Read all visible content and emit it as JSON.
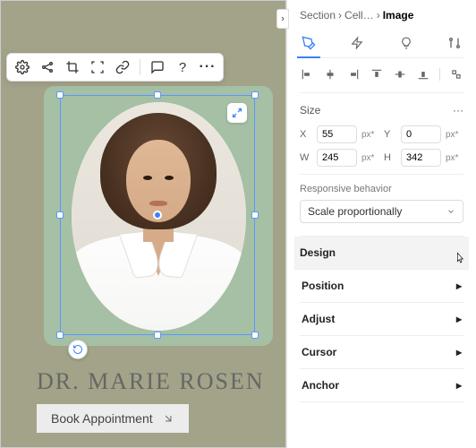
{
  "breadcrumb": {
    "section": "Section",
    "cell": "Cell…",
    "image": "Image"
  },
  "toolbar": {
    "icons": [
      "gear",
      "connect",
      "crop",
      "focus",
      "link",
      "comment",
      "help",
      "more"
    ]
  },
  "size_section": {
    "label": "Size",
    "x_label": "X",
    "x_value": "55",
    "x_unit": "px*",
    "y_label": "Y",
    "y_value": "0",
    "y_unit": "px*",
    "w_label": "W",
    "w_value": "245",
    "w_unit": "px*",
    "h_label": "H",
    "h_value": "342",
    "h_unit": "px*"
  },
  "responsive": {
    "label": "Responsive behavior",
    "value": "Scale proportionally"
  },
  "accordion": {
    "design": "Design",
    "position": "Position",
    "adjust": "Adjust",
    "cursor": "Cursor",
    "anchor": "Anchor"
  },
  "canvas": {
    "heading": "DR. MARIE ROSEN",
    "cta": "Book Appointment"
  }
}
